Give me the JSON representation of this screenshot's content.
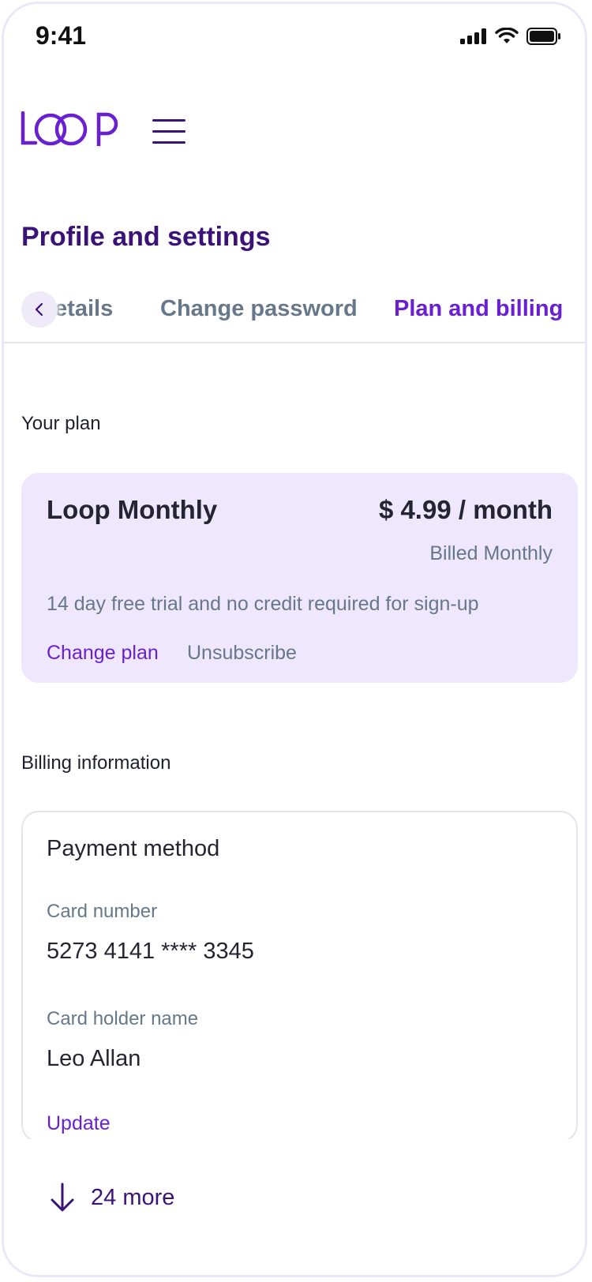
{
  "status_bar": {
    "time": "9:41"
  },
  "header": {
    "logo_text": "LOOP"
  },
  "page": {
    "title": "Profile and settings"
  },
  "tabs": [
    {
      "label": "letails"
    },
    {
      "label": "Change password"
    },
    {
      "label": "Plan and billing"
    }
  ],
  "plan_section": {
    "label": "Your plan",
    "name": "Loop Monthly",
    "price": "$ 4.99 / month",
    "billing_cycle": "Billed Monthly",
    "description": "14 day free trial and no credit required for sign-up",
    "change_plan": "Change plan",
    "unsubscribe": "Unsubscribe"
  },
  "billing_section": {
    "label": "Billing information",
    "card_title": "Payment method",
    "card_number_label": "Card number",
    "card_number": "5273 4141 **** 3345",
    "holder_label": "Card holder name",
    "holder_name": "Leo Allan",
    "update": "Update"
  },
  "more": {
    "label": "24 more"
  },
  "colors": {
    "accent": "#6a1fd1",
    "heading": "#3b1378",
    "muted": "#66788a",
    "plan_card_bg": "#efe7fd"
  }
}
